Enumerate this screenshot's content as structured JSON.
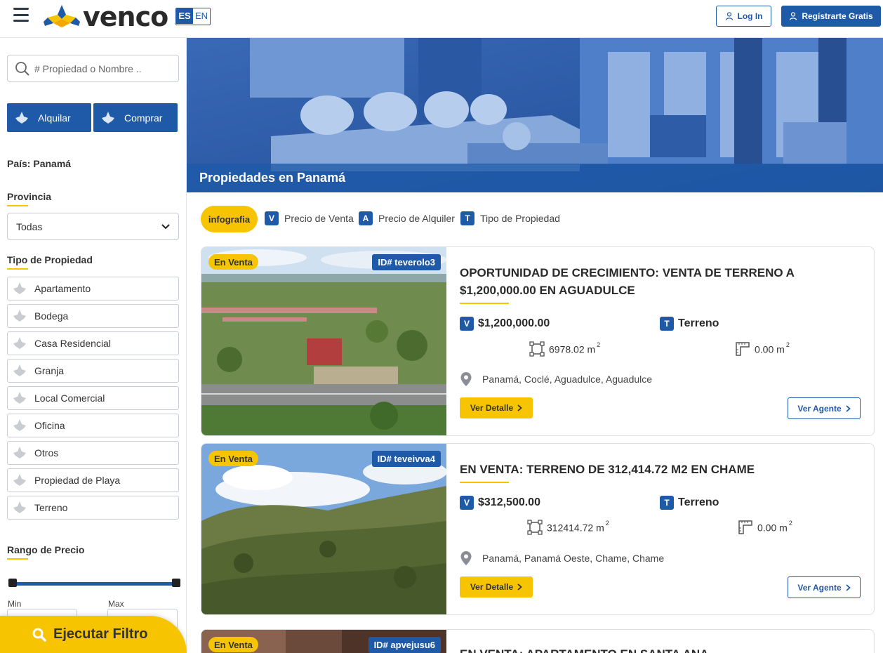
{
  "header": {
    "logo_text": "venco",
    "lang_active": "ES",
    "lang_inactive": "EN",
    "login_label": "Log In",
    "register_label": "Regístrarte Gratis",
    "icons": [
      "menu-icon",
      "user-icon"
    ]
  },
  "sidebar": {
    "search_placeholder": "# Propiedad o Nombre ..",
    "rent_label": "Alquilar",
    "buy_label": "Comprar",
    "country_label": "País: Panamá",
    "province_title": "Provincia",
    "province_value": "Todas",
    "types_title": "Tipo de Propiedad",
    "types": [
      "Apartamento",
      "Bodega",
      "Casa Residencial",
      "Granja",
      "Local Comercial",
      "Oficina",
      "Otros",
      "Propiedad de Playa",
      "Terreno"
    ],
    "price_title": "Rango de Precio",
    "min_label": "Min",
    "max_label": "Max",
    "execute_label": "Ejecutar Filtro"
  },
  "hero": {
    "title": "Propiedades en Panamá"
  },
  "legend": {
    "infografia": "infografia",
    "items": [
      {
        "letter": "V",
        "label": "Precio de Venta"
      },
      {
        "letter": "A",
        "label": "Precio de Alquiler"
      },
      {
        "letter": "T",
        "label": "Tipo de Propiedad"
      }
    ]
  },
  "listings": [
    {
      "status": "En Venta",
      "id": "ID# teverolo3",
      "title": "OPORTUNIDAD DE CRECIMIENTO: VENTA DE TERRENO A $1,200,000.00 EN AGUADULCE",
      "price_letter": "V",
      "price": "$1,200,000.00",
      "type_letter": "T",
      "type": "Terreno",
      "land_area": "6978.02 m",
      "built_area": "0.00 m",
      "area_unit_sup": "2",
      "location": "Panamá, Coclé, Aguadulce, Aguadulce",
      "detail_label": "Ver Detalle",
      "agent_label": "Ver Agente"
    },
    {
      "status": "En Venta",
      "id": "ID# teveivva4",
      "title": "EN VENTA: TERRENO DE 312,414.72 M2 EN CHAME",
      "price_letter": "V",
      "price": "$312,500.00",
      "type_letter": "T",
      "type": "Terreno",
      "land_area": "312414.72 m",
      "built_area": "0.00 m",
      "area_unit_sup": "2",
      "location": "Panamá, Panamá Oeste, Chame, Chame",
      "detail_label": "Ver Detalle",
      "agent_label": "Ver Agente"
    },
    {
      "status": "En Venta",
      "id": "ID# apvejusu6",
      "title": "EN VENTA: APARTAMENTO EN SANTA ANA"
    }
  ],
  "colors": {
    "brand_blue": "#1e5aa8",
    "accent_yellow": "#f6c400"
  }
}
